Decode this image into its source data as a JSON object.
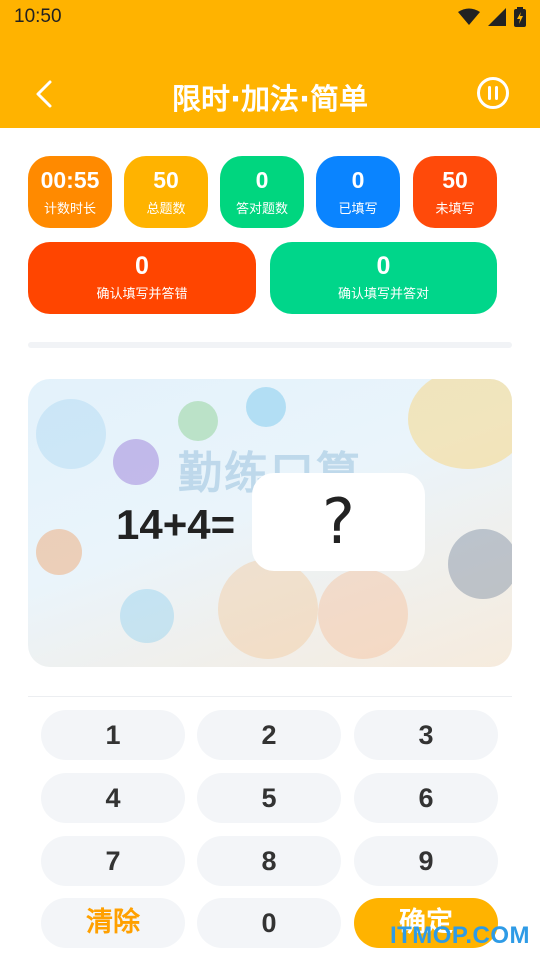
{
  "status": {
    "time": "10:50"
  },
  "header": {
    "title": "限时·加法·简单"
  },
  "stats": [
    {
      "value": "00:55",
      "label": "计数时长",
      "color": "#FF8A00"
    },
    {
      "value": "50",
      "label": "总题数",
      "color": "#FFB300"
    },
    {
      "value": "0",
      "label": "答对题数",
      "color": "#00D67F"
    },
    {
      "value": "0",
      "label": "已填写",
      "color": "#0A84FF"
    },
    {
      "value": "50",
      "label": "未填写",
      "color": "#FF4A0A"
    }
  ],
  "wide_stats": [
    {
      "value": "0",
      "label": "确认填写并答错",
      "color": "#FF4500"
    },
    {
      "value": "0",
      "label": "确认填写并答对",
      "color": "#00D68A"
    }
  ],
  "card": {
    "background_text": "勤练口算",
    "question": "14+4=",
    "answer_placeholder": "?"
  },
  "keypad": {
    "keys": [
      "1",
      "2",
      "3",
      "4",
      "5",
      "6",
      "7",
      "8",
      "9"
    ],
    "clear": "清除",
    "zero": "0",
    "confirm": "确定"
  },
  "watermark": "ITMOP.COM"
}
